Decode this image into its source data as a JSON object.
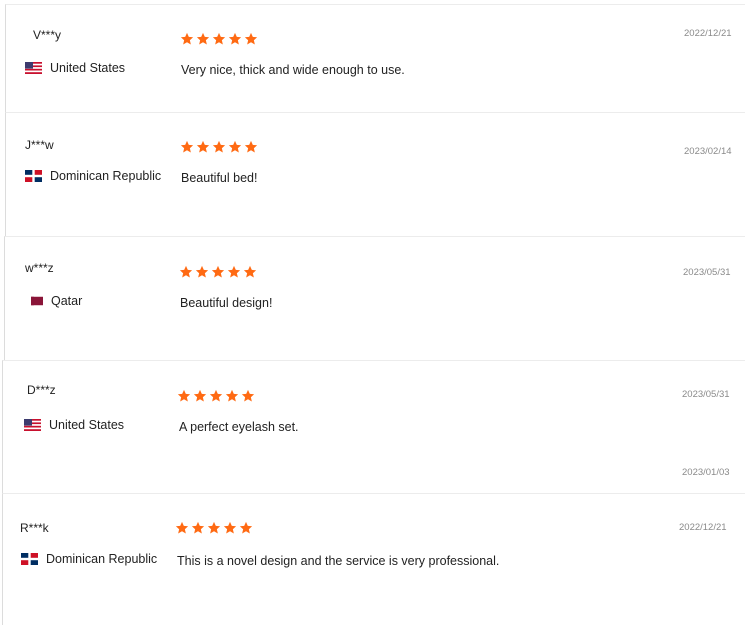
{
  "reviews": [
    {
      "name": "V***y",
      "country": "United States",
      "flag_icon": "us-flag-icon",
      "rating": 5,
      "text": "Very nice, thick and wide enough to use.",
      "date": "2022/12/21"
    },
    {
      "name": "J***w",
      "country": "Dominican Republic",
      "flag_icon": "dominican-republic-flag-icon",
      "rating": 5,
      "text": "Beautiful bed!",
      "date": "2023/02/14"
    },
    {
      "name": "w***z",
      "country": "Qatar",
      "flag_icon": "qatar-flag-icon",
      "rating": 5,
      "text": "Beautiful design!",
      "date": "2023/05/31"
    },
    {
      "name": "D***z",
      "country": "United States",
      "flag_icon": "us-flag-icon",
      "rating": 5,
      "text": "A perfect eyelash set.",
      "date": "2023/05/31"
    },
    {
      "name": "R***k",
      "country": "Dominican Republic",
      "flag_icon": "dominican-republic-flag-icon",
      "rating": 5,
      "text": "This is a novel design and the service is very professional.",
      "date": "2022/12/21"
    }
  ],
  "extra_date": "2023/01/03",
  "colors": {
    "star": "#ff6a13",
    "date": "#8a8a8a",
    "text": "#222222"
  }
}
